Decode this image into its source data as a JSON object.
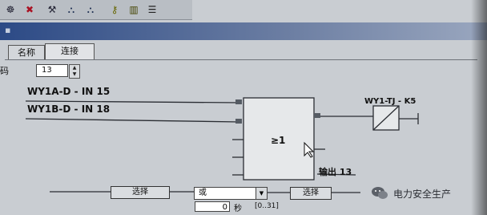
{
  "tabs": {
    "name": "名称",
    "connect": "连接"
  },
  "code_label": "码",
  "code_value": "13",
  "inputs": [
    {
      "label": "WY1A-D - IN 15"
    },
    {
      "label": "WY1B-D - IN 18"
    }
  ],
  "logic_block": {
    "symbol": "≥1"
  },
  "output": {
    "label": "输出 13"
  },
  "relay": {
    "label": "WY1-TJ - K5"
  },
  "footer": {
    "select_left": "选择",
    "mode_value": "或",
    "select_right": "选择",
    "delay_value": "0",
    "delay_unit": "秒",
    "delay_range": "[0..31]"
  },
  "watermark": "电力安全生产",
  "colors": {
    "titlebar": "#2c4a86",
    "background": "#c9cdd2"
  }
}
